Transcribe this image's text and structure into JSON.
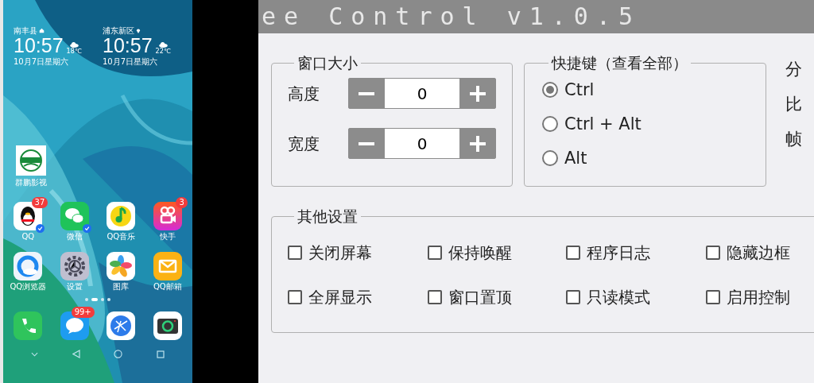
{
  "title_bar": {
    "title": "ee Control v1.0.5"
  },
  "phone": {
    "widgets": [
      {
        "location": "南丰县",
        "kind": "home",
        "time": "10:57",
        "temperature": "18℃",
        "date": "10月7日星期六"
      },
      {
        "location": "浦东新区",
        "kind": "pin",
        "time": "10:57",
        "temperature": "22℃",
        "date": "10月7日星期六"
      }
    ],
    "shortcut": {
      "label": "群鹏影视"
    },
    "apps": [
      {
        "kind": "qq",
        "label": "QQ",
        "badge": "37",
        "verified": true
      },
      {
        "kind": "wechat",
        "label": "微信",
        "verified": true
      },
      {
        "kind": "music",
        "label": "QQ音乐",
        "verified": false
      },
      {
        "kind": "kuaishou",
        "label": "快手",
        "badge": "3",
        "verified": false
      },
      {
        "kind": "browser",
        "label": "QQ浏览器",
        "verified": false
      },
      {
        "kind": "settings",
        "label": "设置",
        "verified": false
      },
      {
        "kind": "gallery",
        "label": "图库",
        "verified": false
      },
      {
        "kind": "mail",
        "label": "QQ邮箱",
        "verified": false
      }
    ],
    "page_dots": [
      {
        "selected": false
      },
      {
        "selected": true
      },
      {
        "selected": false
      },
      {
        "selected": false
      }
    ],
    "dock": [
      {
        "kind": "phone"
      },
      {
        "kind": "message",
        "badge": "99+"
      },
      {
        "kind": "globe"
      },
      {
        "kind": "camera"
      }
    ]
  },
  "window_size": {
    "title": "窗口大小",
    "rows": [
      {
        "label": "高度",
        "value": "0"
      },
      {
        "label": "宽度",
        "value": "0"
      }
    ]
  },
  "hotkeys": {
    "title": "快捷键（查看全部）",
    "options": [
      {
        "label": "Ctrl",
        "selected": true
      },
      {
        "label": "Ctrl + Alt",
        "selected": false
      },
      {
        "label": "Alt",
        "selected": false
      }
    ]
  },
  "side_labels": [
    "分",
    "比",
    "帧"
  ],
  "other_settings": {
    "title": "其他设置",
    "options": [
      {
        "label": "关闭屏幕",
        "checked": false
      },
      {
        "label": "保持唤醒",
        "checked": false
      },
      {
        "label": "程序日志",
        "checked": false
      },
      {
        "label": "隐藏边框",
        "checked": false
      },
      {
        "label": "全屏显示",
        "checked": false
      },
      {
        "label": "窗口置顶",
        "checked": false
      },
      {
        "label": "只读模式",
        "checked": false
      },
      {
        "label": "启用控制",
        "checked": false
      }
    ]
  }
}
